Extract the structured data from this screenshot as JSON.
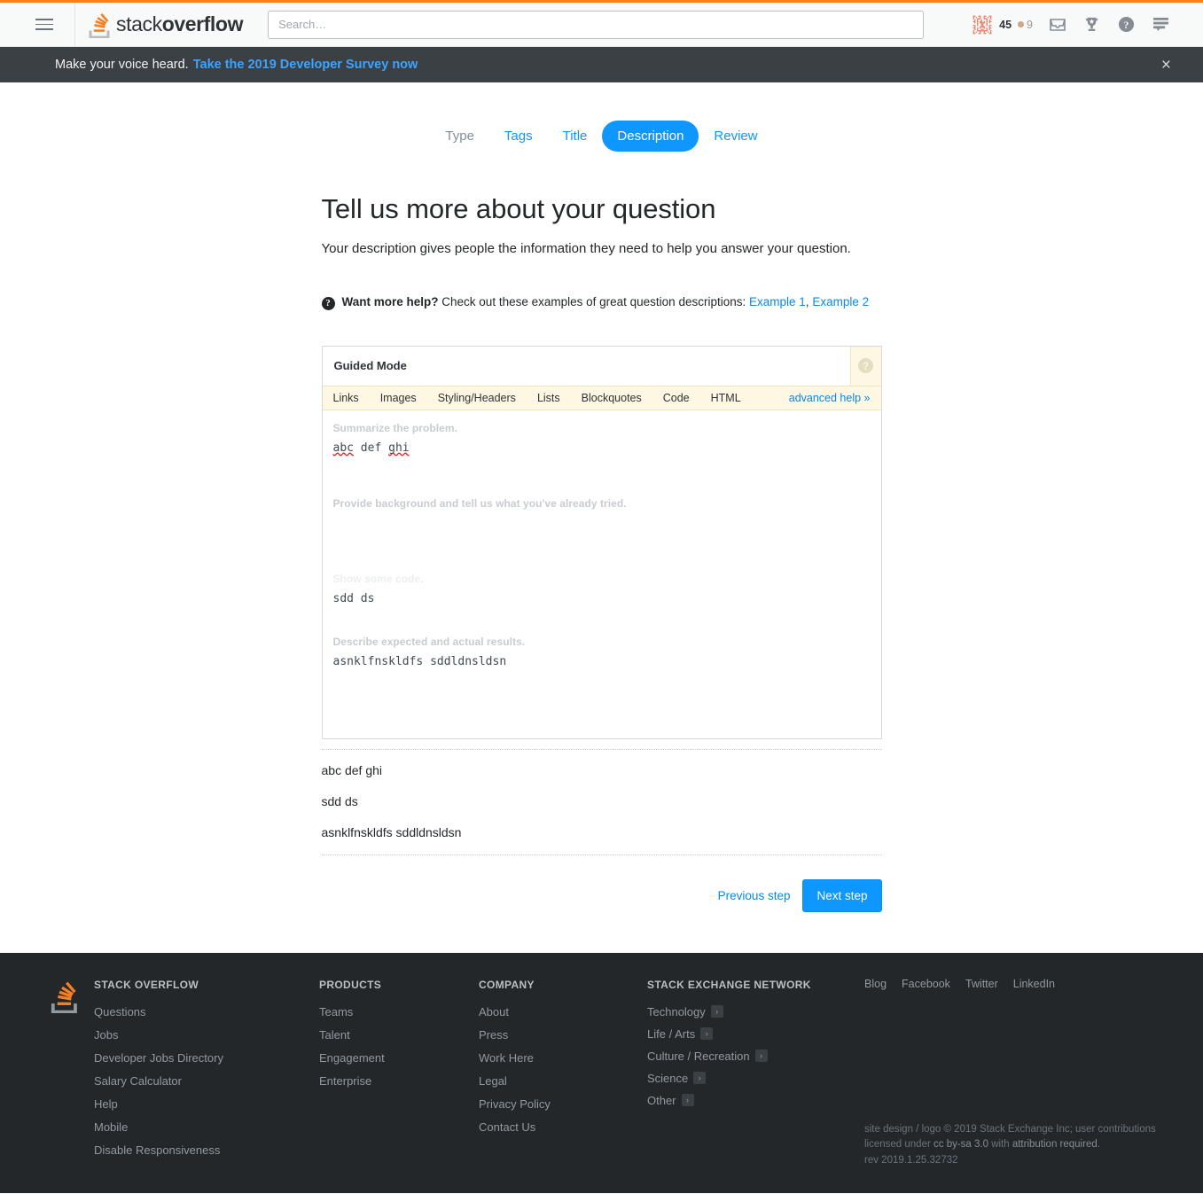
{
  "topnav": {
    "hamburger_label": "Menu",
    "logo_text_light": "stack",
    "logo_text_bold": "overflow",
    "search_placeholder": "Search…",
    "search_value": "",
    "reputation": "45",
    "bronze_badges": "9",
    "accent_color": "#f48024"
  },
  "banner": {
    "text": "Make your voice heard.",
    "link": "Take the 2019 Developer Survey now",
    "close_label": "×",
    "background": "#3b4045",
    "link_color": "#3ca4ff"
  },
  "steps": {
    "items": [
      {
        "label": "Type",
        "state": "done"
      },
      {
        "label": "Tags",
        "state": "link"
      },
      {
        "label": "Title",
        "state": "link"
      },
      {
        "label": "Description",
        "state": "active"
      },
      {
        "label": "Review",
        "state": "link"
      }
    ],
    "active_color": "#0d97ff"
  },
  "main": {
    "title": "Tell us more about your question",
    "lede": "Your description gives people the information they need to help you answer your question.",
    "help": {
      "icon": "question-mark-circle-icon",
      "strong": "Want more help?",
      "text": "Check out these examples of great question descriptions:",
      "links": [
        "Example 1",
        "Example 2"
      ],
      "separator": ","
    }
  },
  "editor": {
    "mode_label": "Guided Mode",
    "help_tab_icon": "help-question-icon",
    "toolbar": {
      "items": [
        "Links",
        "Images",
        "Styling/Headers",
        "Lists",
        "Blockquotes",
        "Code",
        "HTML"
      ],
      "advanced_help": "advanced help »",
      "background": "#fdf7e3"
    },
    "sections": [
      {
        "hint": "Summarize the problem.",
        "hint_faded": false,
        "value": "abc def ghi"
      },
      {
        "hint": "Provide background and tell us what you've already tried.",
        "hint_faded": false,
        "value": ""
      },
      {
        "hint": "Show some code.",
        "hint_faded": true,
        "value": "sdd ds"
      },
      {
        "hint": "Describe expected and actual results.",
        "hint_faded": false,
        "value": "asnklfnskldfs sddldnsldsn"
      }
    ]
  },
  "preview": {
    "paragraphs": [
      "abc def ghi",
      "sdd ds",
      "asnklfnskldfs sddldnsldsn"
    ]
  },
  "actions": {
    "previous": "Previous step",
    "next": "Next step"
  },
  "footer": {
    "logo_icon": "stack-overflow-logo-icon",
    "columns": [
      {
        "heading": "STACK OVERFLOW",
        "links": [
          "Questions",
          "Jobs",
          "Developer Jobs Directory",
          "Salary Calculator",
          "Help",
          "Mobile",
          "Disable Responsiveness"
        ]
      },
      {
        "heading": "PRODUCTS",
        "links": [
          "Teams",
          "Talent",
          "Engagement",
          "Enterprise"
        ]
      },
      {
        "heading": "COMPANY",
        "links": [
          "About",
          "Press",
          "Work Here",
          "Legal",
          "Privacy Policy",
          "Contact Us"
        ]
      }
    ],
    "network": {
      "heading": "STACK EXCHANGE NETWORK",
      "items": [
        "Technology",
        "Life / Arts",
        "Culture / Recreation",
        "Science",
        "Other"
      ]
    },
    "social": [
      "Blog",
      "Facebook",
      "Twitter",
      "LinkedIn"
    ],
    "copyright": {
      "line1_a": "site design / logo © 2019 Stack Exchange Inc; user contributions licensed under ",
      "license": "cc by-sa 3.0",
      "line1_b": " with ",
      "attribution": "attribution required",
      "line1_c": ".",
      "rev": "rev 2019.1.25.32732"
    },
    "background": "#242729"
  }
}
